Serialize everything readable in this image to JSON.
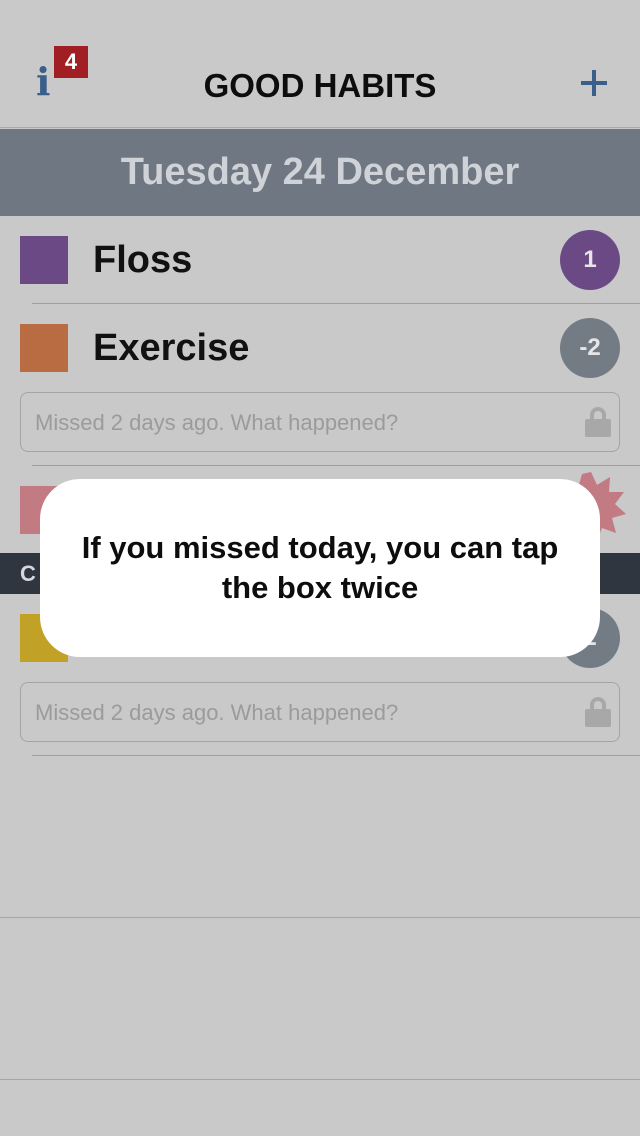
{
  "header": {
    "title": "GOOD HABITS",
    "info_icon": "info-icon",
    "info_badge": "4",
    "add_icon": "plus-icon",
    "accent_color": "#3a5f8a",
    "badge_color": "#a11e25"
  },
  "date": "Tuesday 24 December",
  "habits": [
    {
      "name": "Floss",
      "color": "#6b4985",
      "streak": "1",
      "streak_color": "#6b4985"
    },
    {
      "name": "Exercise",
      "color": "#b96b42",
      "streak": "-2",
      "streak_color": "#737b85",
      "note_placeholder": "Missed 2 days ago. What happened?"
    },
    {
      "color": "#c27b83",
      "streak_color": "#c27b83"
    },
    {
      "color": "#c1a126",
      "streak": "2",
      "streak_color": "#737b85",
      "note_placeholder": "Missed 2 days ago. What happened?"
    }
  ],
  "category_label": "C",
  "popup": {
    "message": "If you missed today, you can tap the box twice"
  },
  "colors": {
    "background": "#c9c9c9",
    "date_bar": "#6f7782",
    "category_bar": "#2f3640"
  }
}
